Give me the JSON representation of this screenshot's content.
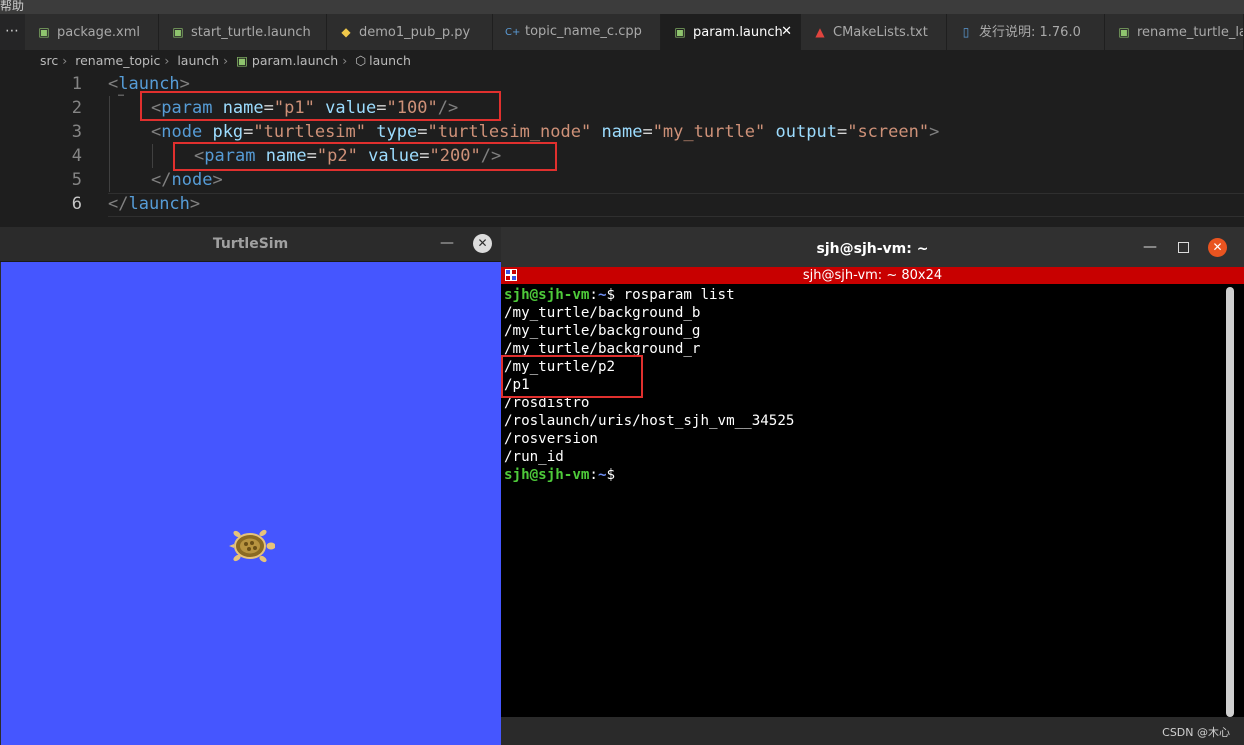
{
  "top_menu": {
    "text": "帮助"
  },
  "tabs": [
    {
      "label": "package.xml",
      "icon": "xml-file-icon",
      "glyph": "▣",
      "color": "#8fc46e"
    },
    {
      "label": "start_turtle.launch",
      "icon": "launch-file-icon",
      "glyph": "▣",
      "color": "#8fc46e"
    },
    {
      "label": "demo1_pub_p.py",
      "icon": "python-file-icon",
      "glyph": "◆",
      "color": "#f0c84a"
    },
    {
      "label": "topic_name_c.cpp",
      "icon": "cpp-file-icon",
      "glyph": "C+",
      "color": "#5b9bd5"
    },
    {
      "label": "param.launch",
      "icon": "launch-file-icon",
      "glyph": "▣",
      "color": "#8fc46e",
      "active": true
    },
    {
      "label": "CMakeLists.txt",
      "icon": "cmake-file-icon",
      "glyph": "▲",
      "color": "#e0443e"
    },
    {
      "label": "发行说明: 1.76.0",
      "icon": "document-icon",
      "glyph": "▯",
      "color": "#5b9bd5"
    },
    {
      "label": "rename_turtle_lau",
      "icon": "launch-file-icon",
      "glyph": "▣",
      "color": "#8fc46e"
    }
  ],
  "tab_close": "✕",
  "tab_overflow": "⋯",
  "breadcrumb": [
    "src",
    "rename_topic",
    "launch",
    "param.launch",
    "launch"
  ],
  "editor": {
    "line_numbers": [
      "1",
      "2",
      "3",
      "4",
      "5",
      "6"
    ],
    "current_line": 6,
    "fold_hint": "…",
    "l1": {
      "open": "<",
      "tag": "launch",
      "close": ">"
    },
    "l2": {
      "open": "<",
      "tag": "param",
      "a1": "name",
      "v1": "\"p1\"",
      "a2": "value",
      "v2": "\"100\"",
      "close": "/>"
    },
    "l3": {
      "open": "<",
      "tag": "node",
      "a1": "pkg",
      "v1": "\"turtlesim\"",
      "a2": "type",
      "v2": "\"turtlesim_node\"",
      "a3": "name",
      "v3": "\"my_turtle\"",
      "a4": "output",
      "v4": "\"screen\"",
      "close": ">"
    },
    "l4": {
      "open": "<",
      "tag": "param",
      "a1": "name",
      "v1": "\"p2\"",
      "a2": "value",
      "v2": "\"200\"",
      "close": "/>"
    },
    "l5": {
      "open": "</",
      "tag": "node",
      "close": ">"
    },
    "l6": {
      "open": "</",
      "tag": "launch",
      "close": ">"
    },
    "eq": "="
  },
  "turtlesim": {
    "title": "TurtleSim",
    "minimize": "—",
    "close": "✕",
    "background": "#4556ff"
  },
  "terminal": {
    "title": "sjh@sjh-vm: ~",
    "status": "sjh@sjh-vm: ~ 80x24",
    "minimize": "—",
    "close": "✕",
    "prompt_user": "sjh@sjh-vm",
    "prompt_colon": ":",
    "prompt_path": "~",
    "prompt_dollar": "$",
    "command": " rosparam list",
    "output": [
      "/my_turtle/background_b",
      "/my_turtle/background_g",
      "/my_turtle/background_r",
      "/my_turtle/p2",
      "/p1",
      "/rosdistro",
      "/roslaunch/uris/host_sjh_vm__34525",
      "/rosversion",
      "/run_id"
    ]
  },
  "watermark": "CSDN @木心"
}
